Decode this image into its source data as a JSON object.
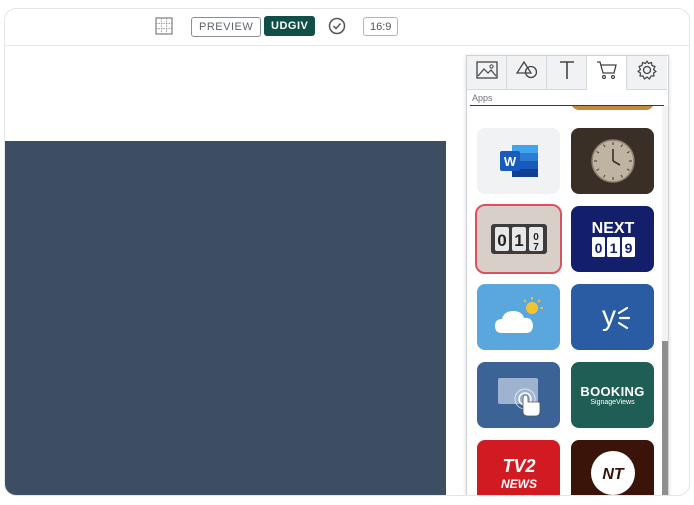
{
  "toolbar": {
    "grid_icon": "grid-icon",
    "preview_label": "PREVIEW",
    "publish_label": "UDGIV",
    "check_icon": "check-circle-icon",
    "aspect_ratio": "16:9"
  },
  "panel": {
    "tabs": [
      {
        "icon": "image-icon"
      },
      {
        "icon": "shapes-icon"
      },
      {
        "icon": "text-icon"
      },
      {
        "icon": "cart-icon",
        "active": true
      },
      {
        "icon": "settings-icon"
      }
    ],
    "section_label": "Apps",
    "apps": [
      {
        "name": "word-app-icon"
      },
      {
        "name": "clock-app-icon"
      },
      {
        "name": "counter-app-icon",
        "selected": true,
        "digits": "01"
      },
      {
        "name": "next-counter-app-icon",
        "title": "NEXT",
        "digits": "01"
      },
      {
        "name": "weather-app-icon"
      },
      {
        "name": "yammer-app-icon"
      },
      {
        "name": "touch-screen-app-icon"
      },
      {
        "name": "booking-app-icon",
        "title": "BOOKING",
        "subtitle": "SignageViews"
      },
      {
        "name": "tv2-news-app-icon",
        "title": "TV2",
        "subtitle": "NEWS"
      },
      {
        "name": "nt-app-icon",
        "title": "NT"
      }
    ]
  },
  "colors": {
    "canvas": "#3e4e62",
    "publish": "#0f4f47",
    "selected_outline": "#e0505b"
  }
}
